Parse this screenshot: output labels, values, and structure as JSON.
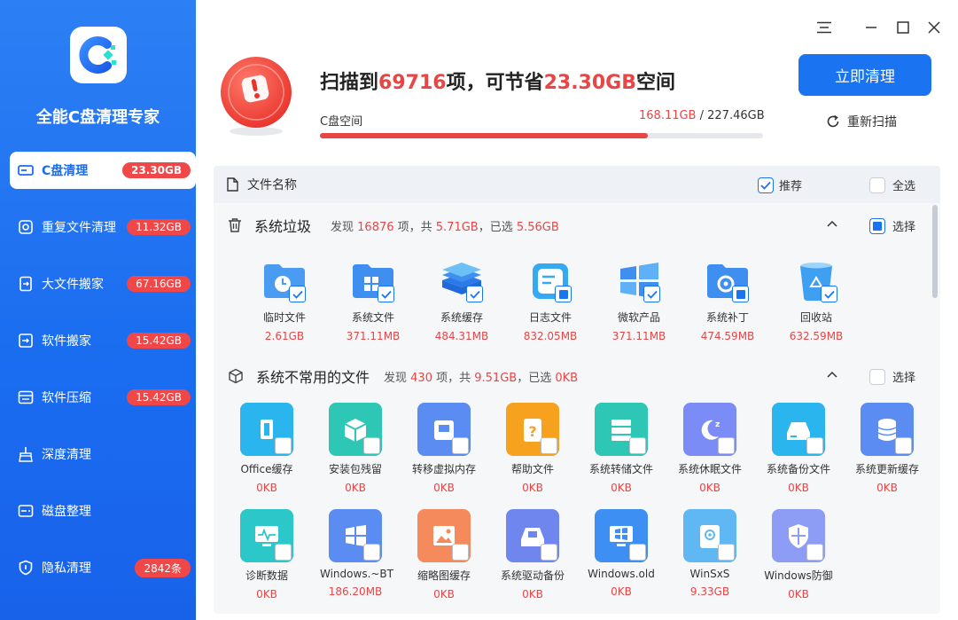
{
  "app": {
    "title": "全能C盘清理专家"
  },
  "nav": [
    {
      "label": "C盘清理",
      "badge": "23.30GB",
      "icon": "drive-icon"
    },
    {
      "label": "重复文件清理",
      "badge": "11.32GB",
      "icon": "duplicate-icon"
    },
    {
      "label": "大文件搬家",
      "badge": "67.16GB",
      "icon": "file-move-icon"
    },
    {
      "label": "软件搬家",
      "badge": "15.42GB",
      "icon": "app-move-icon"
    },
    {
      "label": "软件压缩",
      "badge": "15.42GB",
      "icon": "compress-icon"
    },
    {
      "label": "深度清理",
      "badge": "",
      "icon": "broom-icon"
    },
    {
      "label": "磁盘整理",
      "badge": "",
      "icon": "disk-icon"
    },
    {
      "label": "隐私清理",
      "badge": "2842条",
      "icon": "shield-icon"
    }
  ],
  "summary": {
    "prefix": "扫描到",
    "count": "69716",
    "mid": "项，可节省",
    "size": "23.30GB",
    "suffix": "空间"
  },
  "space": {
    "label": "C盘空间",
    "used": "168.11GB",
    "sep": " / ",
    "total": "227.46GB",
    "used_fraction": 0.739
  },
  "actions": {
    "clean": "立即清理",
    "rescan": "重新扫描"
  },
  "table": {
    "file_name": "文件名称",
    "recommend": "推荐",
    "select_all": "全选"
  },
  "sections": [
    {
      "title": "系统垃圾",
      "info_pre": "发现 ",
      "found": "16876",
      "info_mid": " 项，共 ",
      "total": "5.71GB",
      "info_mid2": "，已选 ",
      "selected": "5.56GB",
      "select": "选择",
      "items": [
        {
          "label": "临时文件",
          "size": "2.61GB",
          "icon": "temp-folder-icon",
          "checked": true
        },
        {
          "label": "系统文件",
          "size": "371.11MB",
          "icon": "system-folder-icon",
          "checked": true
        },
        {
          "label": "系统缓存",
          "size": "484.31MB",
          "icon": "layers-icon",
          "checked": true
        },
        {
          "label": "日志文件",
          "size": "832.05MB",
          "icon": "log-file-icon",
          "checked": "partial"
        },
        {
          "label": "微软产品",
          "size": "371.11MB",
          "icon": "windows-logo-icon",
          "checked": true
        },
        {
          "label": "系统补丁",
          "size": "474.59MB",
          "icon": "patch-folder-icon",
          "checked": "partial"
        },
        {
          "label": "回收站",
          "size": "632.59MB",
          "icon": "recycle-bin-icon",
          "checked": true
        }
      ]
    },
    {
      "title": "系统不常用的文件",
      "info_pre": "发现 ",
      "found": "430",
      "info_mid": " 项，共 ",
      "total": "9.51GB",
      "info_mid2": "，已选 ",
      "selected": "0KB",
      "select": "选择",
      "items": [
        {
          "label": "Office缓存",
          "size": "0KB",
          "icon": "office-icon",
          "color": "#2bb5ee"
        },
        {
          "label": "安装包残留",
          "size": "0KB",
          "icon": "package-icon",
          "color": "#2ec6b4"
        },
        {
          "label": "转移虚拟内存",
          "size": "0KB",
          "icon": "memory-icon",
          "color": "#5a8cf2"
        },
        {
          "label": "帮助文件",
          "size": "0KB",
          "icon": "help-file-icon",
          "color": "#f6a21e"
        },
        {
          "label": "系统转储文件",
          "size": "0KB",
          "icon": "server-icon",
          "color": "#2ec6b4"
        },
        {
          "label": "系统休眠文件",
          "size": "0KB",
          "icon": "sleep-icon",
          "color": "#7c8cf6"
        },
        {
          "label": "系统备份文件",
          "size": "0KB",
          "icon": "backup-icon",
          "color": "#2bb5ee"
        },
        {
          "label": "系统更新缓存",
          "size": "0KB",
          "icon": "database-icon",
          "color": "#5a8cf2"
        },
        {
          "label": "诊断数据",
          "size": "0KB",
          "icon": "diagnostic-icon",
          "color": "#2bc7c9"
        },
        {
          "label": "Windows.~BT",
          "size": "186.20MB",
          "icon": "windows-bt-icon",
          "color": "#5a8cf2"
        },
        {
          "label": "缩略图缓存",
          "size": "0KB",
          "icon": "thumbnail-icon",
          "color": "#f58a5c"
        },
        {
          "label": "系统驱动备份",
          "size": "0KB",
          "icon": "driver-icon",
          "color": "#6f86ee"
        },
        {
          "label": "Windows.old",
          "size": "0KB",
          "icon": "windows-old-icon",
          "color": "#3d8ff3"
        },
        {
          "label": "WinSxS",
          "size": "9.33GB",
          "icon": "winsxs-icon",
          "color": "#5fb8f4"
        },
        {
          "label": "Windows防御",
          "size": "0KB",
          "icon": "defender-icon",
          "color": "#8d9cf4"
        }
      ]
    }
  ]
}
